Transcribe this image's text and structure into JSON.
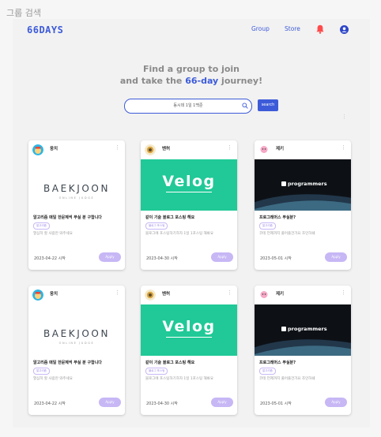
{
  "page": {
    "caption": "그룹 검색"
  },
  "header": {
    "logo": "66DAYS",
    "nav": [
      {
        "label": "Group"
      },
      {
        "label": "Store"
      }
    ],
    "bell_icon": "bell-icon",
    "user_icon": "user-avatar-icon",
    "bell_color": "#ff4b4b",
    "accent_color": "#3d5bd9"
  },
  "hero": {
    "line1": "Find a group to join",
    "line2_prefix": "and take the ",
    "line2_accent": "66-day",
    "line2_suffix": " journey!"
  },
  "search": {
    "value": "동시데 1일 1백준",
    "icon": "search-icon",
    "button_label": "search"
  },
  "cards": [
    {
      "author": "웅치",
      "author_sub": "",
      "thumb": "baekjoon",
      "thumb_word": "BAEKJOON",
      "thumb_sub": "ONLINE JUDGE",
      "title": "알고리즘 매일 한문제씩 푸실 분 구합니다",
      "tag": "알고리즘",
      "desc": "열심히 할 사람만 와주세요",
      "date": "2023-04-22 시작",
      "apply": "Apply"
    },
    {
      "author": "벤허",
      "author_sub": "",
      "thumb": "velog",
      "thumb_word": "Velog",
      "thumb_sub": "",
      "title": "같이 기술 블로그 포스팅 해요",
      "tag": "블로그 포스팅",
      "desc": "블로그에 포스팅하기하자 1일 1포스팅 해봐요",
      "date": "2023-04-30 시작",
      "apply": "Apply"
    },
    {
      "author": "제키",
      "author_sub": "",
      "thumb": "programmers",
      "thumb_word": "programmers",
      "thumb_sub": "",
      "title": "프로그래머스 푸실분?",
      "tag": "알고리즘",
      "desc": "코테 언제까지 풀어줄건가요 조인하쉐",
      "date": "2023-05-01 시작",
      "apply": "Apply"
    },
    {
      "author": "웅치",
      "author_sub": "",
      "thumb": "baekjoon",
      "thumb_word": "BAEKJOON",
      "thumb_sub": "ONLINE JUDGE",
      "title": "알고리즘 매일 한문제씩 푸실 분 구합니다",
      "tag": "알고리즘",
      "desc": "열심히 할 사람만 와주세요",
      "date": "2023-04-22 시작",
      "apply": "Apply"
    },
    {
      "author": "벤허",
      "author_sub": "",
      "thumb": "velog",
      "thumb_word": "Velog",
      "thumb_sub": "",
      "title": "같이 기술 블로그 포스팅 해요",
      "tag": "블로그 포스팅",
      "desc": "블로그에 포스팅하기하자 1일 1포스팅 해봐요",
      "date": "2023-04-30 시작",
      "apply": "Apply"
    },
    {
      "author": "제키",
      "author_sub": "",
      "thumb": "programmers",
      "thumb_word": "programmers",
      "thumb_sub": "",
      "title": "프로그래머스 푸실분?",
      "tag": "알고리즘",
      "desc": "코테 언제까지 풀어줄건가요 조인하쉐",
      "date": "2023-05-01 시작",
      "apply": "Apply"
    }
  ]
}
